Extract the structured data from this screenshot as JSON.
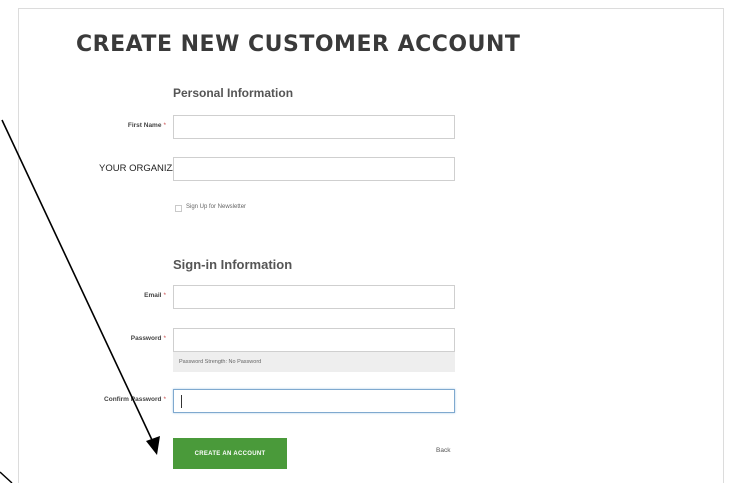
{
  "page": {
    "title": "CREATE NEW CUSTOMER ACCOUNT"
  },
  "personal": {
    "heading": "Personal Information",
    "first_name_label": "First Name",
    "required_mark": "*",
    "organization_name": "YOUR ORGANIZATION NAME",
    "newsletter_label": "Sign Up for Newsletter",
    "newsletter_checked": false
  },
  "signin": {
    "heading": "Sign-in Information",
    "email_label": "Email",
    "password_label": "Password",
    "password_strength": "Password Strength: No Password",
    "confirm_password_label": "Confirm Password"
  },
  "actions": {
    "create_label": "CREATE AN ACCOUNT",
    "back_label": "Back"
  },
  "colors": {
    "primary_button": "#4a9a3a",
    "required_mark": "#c94a4a",
    "annotation_arrow": "#000000"
  }
}
